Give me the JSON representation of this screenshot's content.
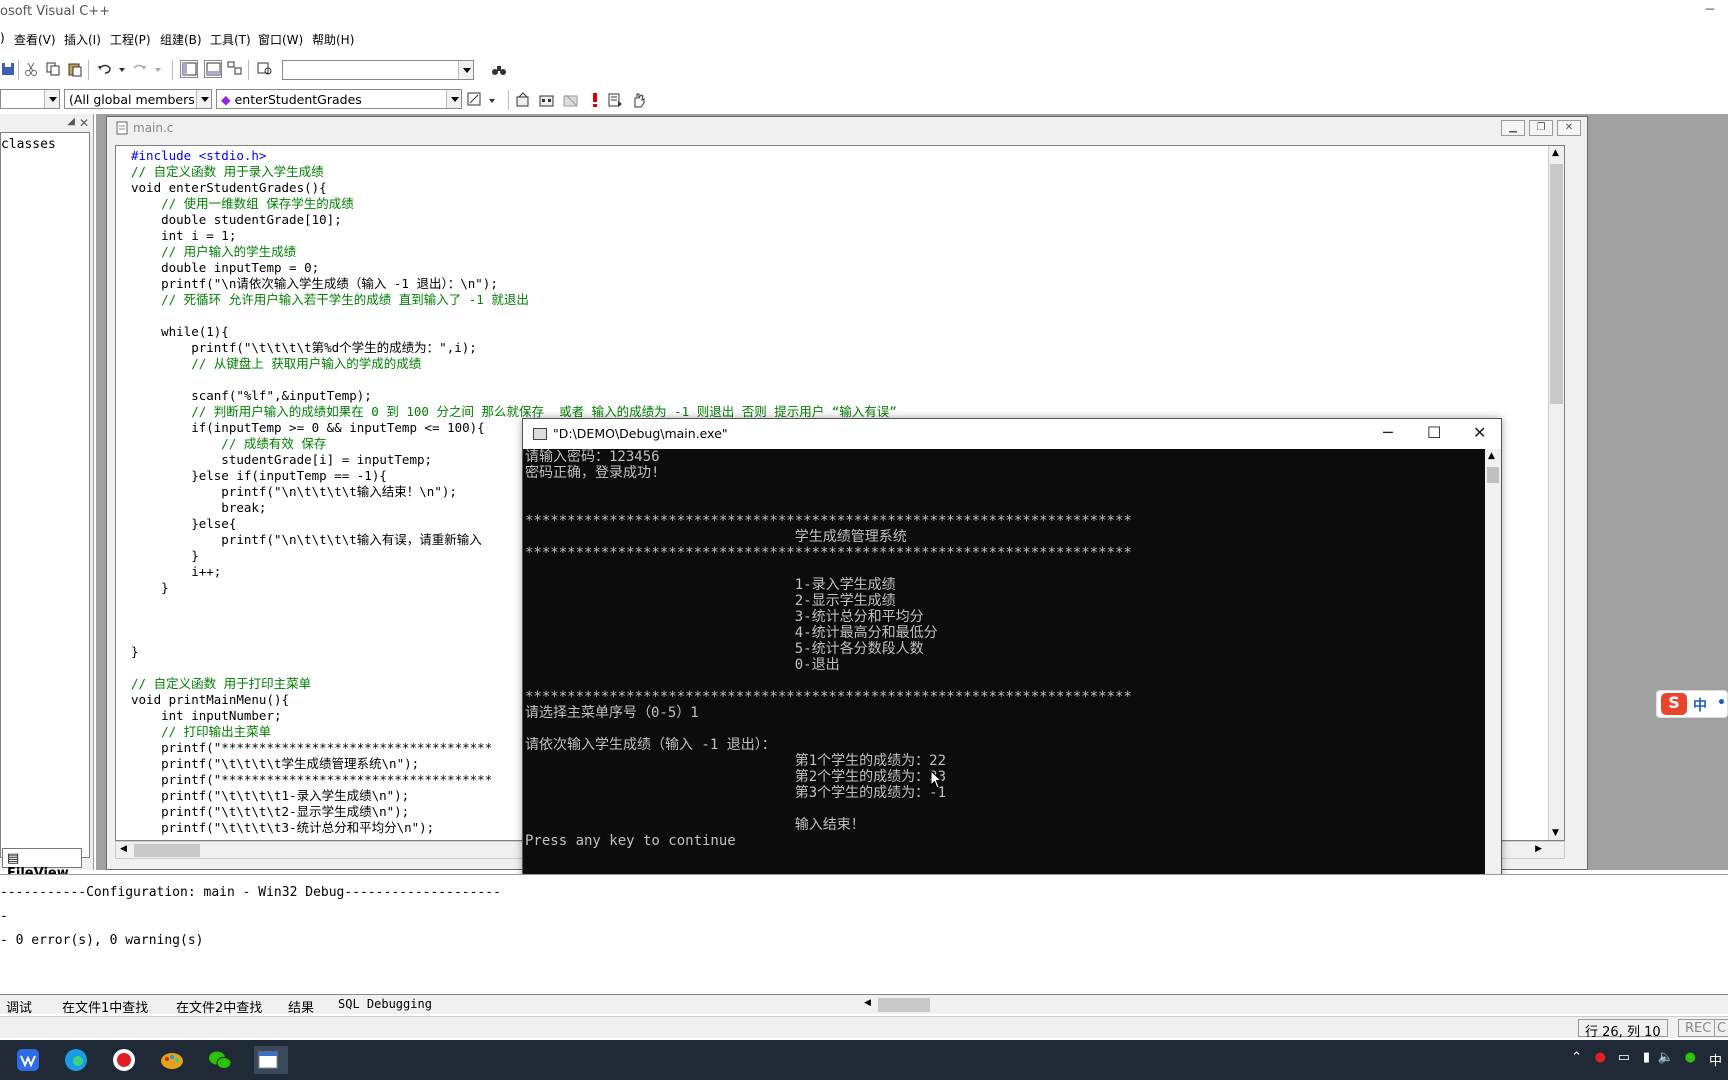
{
  "window": {
    "title": "osoft Visual C++"
  },
  "menu": [
    "查看(V)",
    "插入(I)",
    "工程(P)",
    "组建(B)",
    "工具(T)",
    "窗口(W)",
    "帮助(H)"
  ],
  "toolbar2": {
    "scope_combo": "(All global members",
    "function_combo": "enterStudentGrades"
  },
  "workspace": {
    "tree_item": "classes",
    "tab_label": "FileView"
  },
  "editor": {
    "filename": "main.c",
    "lines": [
      {
        "t": "#include <stdio.h>",
        "c": "kw"
      },
      {
        "t": "// 自定义函数 用于录入学生成绩",
        "c": "cm"
      },
      {
        "t": "void enterStudentGrades(){",
        "c": "nm"
      },
      {
        "t": "    // 使用一维数组 保存学生的成绩",
        "c": "cm"
      },
      {
        "t": "    double studentGrade[10];",
        "c": "nm"
      },
      {
        "t": "    int i = 1;",
        "c": "nm"
      },
      {
        "t": "    // 用户输入的学生成绩",
        "c": "cm"
      },
      {
        "t": "    double inputTemp = 0;",
        "c": "nm"
      },
      {
        "t": "    printf(\"\\n请依次输入学生成绩（输入 -1 退出）：\\n\");",
        "c": "nm"
      },
      {
        "t": "    // 死循环 允许用户输入若干学生的成绩 直到输入了 -1 就退出",
        "c": "cm"
      },
      {
        "t": "",
        "c": "nm"
      },
      {
        "t": "    while(1){",
        "c": "nm"
      },
      {
        "t": "        printf(\"\\t\\t\\t\\t第%d个学生的成绩为：\",i);",
        "c": "nm"
      },
      {
        "t": "        // 从键盘上 获取用户输入的学成的成绩",
        "c": "cm"
      },
      {
        "t": "",
        "c": "nm"
      },
      {
        "t": "        scanf(\"%lf\",&inputTemp);",
        "c": "nm"
      },
      {
        "t": "        // 判断用户输入的成绩如果在 0 到 100 分之间 那么就保存  或者 输入的成绩为 -1 则退出 否则 提示用户 “输入有误”",
        "c": "cm"
      },
      {
        "t": "        if(inputTemp >= 0 && inputTemp <= 100){",
        "c": "nm"
      },
      {
        "t": "            // 成绩有效 保存",
        "c": "cm"
      },
      {
        "t": "            studentGrade[i] = inputTemp;",
        "c": "nm"
      },
      {
        "t": "        }else if(inputTemp == -1){",
        "c": "nm"
      },
      {
        "t": "            printf(\"\\n\\t\\t\\t\\t输入结束！\\n\");",
        "c": "nm"
      },
      {
        "t": "            break;",
        "c": "nm"
      },
      {
        "t": "        }else{",
        "c": "nm"
      },
      {
        "t": "            printf(\"\\n\\t\\t\\t\\t输入有误，请重新输入",
        "c": "nm"
      },
      {
        "t": "        }",
        "c": "nm"
      },
      {
        "t": "        i++;",
        "c": "nm"
      },
      {
        "t": "    }",
        "c": "nm"
      },
      {
        "t": "",
        "c": "nm"
      },
      {
        "t": "",
        "c": "nm"
      },
      {
        "t": "",
        "c": "nm"
      },
      {
        "t": "}",
        "c": "nm"
      },
      {
        "t": "",
        "c": "nm"
      },
      {
        "t": "// 自定义函数 用于打印主菜单",
        "c": "cm"
      },
      {
        "t": "void printMainMenu(){",
        "c": "nm"
      },
      {
        "t": "    int inputNumber;",
        "c": "nm"
      },
      {
        "t": "    // 打印输出主菜单",
        "c": "cm"
      },
      {
        "t": "    printf(\"************************************",
        "c": "nm"
      },
      {
        "t": "    printf(\"\\t\\t\\t\\t学生成绩管理系统\\n\");",
        "c": "nm"
      },
      {
        "t": "    printf(\"************************************",
        "c": "nm"
      },
      {
        "t": "    printf(\"\\t\\t\\t\\t1-录入学生成绩\\n\");",
        "c": "nm"
      },
      {
        "t": "    printf(\"\\t\\t\\t\\t2-显示学生成绩\\n\");",
        "c": "nm"
      },
      {
        "t": "    printf(\"\\t\\t\\t\\t3-统计总分和平均分\\n\");",
        "c": "nm"
      }
    ]
  },
  "console": {
    "title": "\"D:\\DEMO\\Debug\\main.exe\"",
    "lines": [
      "请输入密码：123456",
      "密码正确，登录成功!",
      "",
      "",
      "************************************************************************",
      "                                学生成绩管理系统",
      "************************************************************************",
      "",
      "                                1-录入学生成绩",
      "                                2-显示学生成绩",
      "                                3-统计总分和平均分",
      "                                4-统计最高分和最低分",
      "                                5-统计各分数段人数",
      "                                0-退出",
      "",
      "************************************************************************",
      "请选择主菜单序号（0-5）1",
      "",
      "请依次输入学生成绩（输入 -1 退出）：",
      "                                第1个学生的成绩为：22",
      "                                第2个学生的成绩为：33",
      "                                第3个学生的成绩为：-1",
      "",
      "                                输入结束！",
      "Press any key to continue"
    ]
  },
  "output": {
    "lines": [
      "-----------Configuration: main - Win32 Debug--------------------",
      "-",
      "- 0 error(s), 0 warning(s)"
    ],
    "tabs": [
      "调试",
      "在文件1中查找",
      "在文件2中查找",
      "结果",
      "SQL Debugging"
    ]
  },
  "status": {
    "position": "行 26, 列 10",
    "rec": "REC",
    "col": "C"
  },
  "tray": {
    "ime": "中"
  },
  "colors": {
    "keyword": "#0000ff",
    "comment": "#008000",
    "console_bg": "#0c0c0c",
    "taskbar": "#1f2a36"
  }
}
